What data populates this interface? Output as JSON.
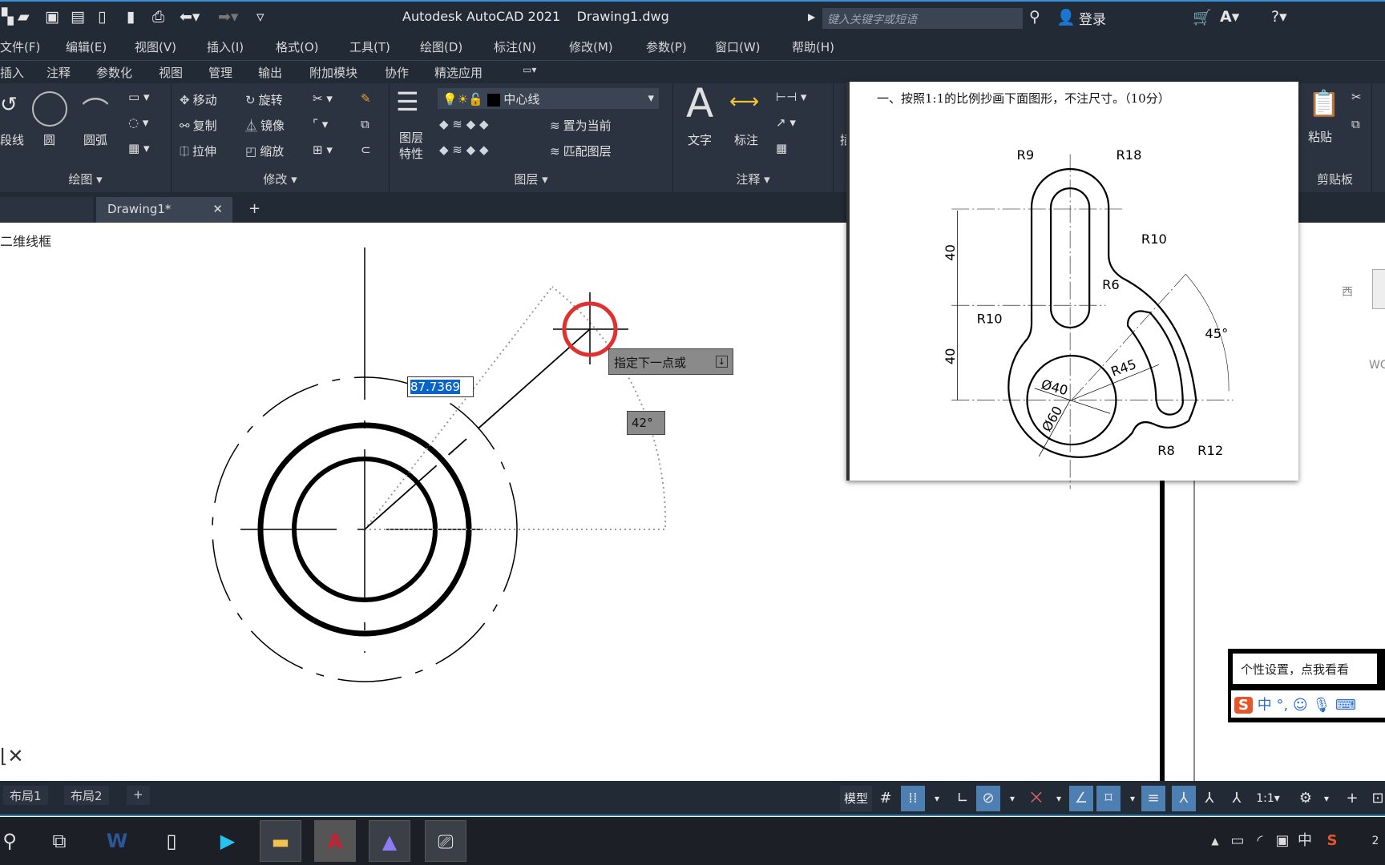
{
  "titlebar": {
    "app_title": "Autodesk AutoCAD 2021    Drawing1.dwg",
    "search_placeholder": "键入关键字或短语",
    "login": "登录",
    "icons": [
      "new-icon",
      "open-icon",
      "save-icon",
      "saveas-icon",
      "import-icon",
      "export-icon",
      "print-icon",
      "undo-icon",
      "redo-icon",
      "customize-icon",
      "search-icon",
      "user-icon",
      "cart-icon",
      "autodesk-icon",
      "help-icon"
    ]
  },
  "menu": [
    "文件(F)",
    "编辑(E)",
    "视图(V)",
    "插入(I)",
    "格式(O)",
    "工具(T)",
    "绘图(D)",
    "标注(N)",
    "修改(M)",
    "参数(P)",
    "窗口(W)",
    "帮助(H)"
  ],
  "ribbon_tabs": [
    "插入",
    "注释",
    "参数化",
    "视图",
    "管理",
    "输出",
    "附加模块",
    "协作",
    "精选应用"
  ],
  "ribbon": {
    "draw": {
      "title": "绘图",
      "tools": [
        "段线",
        "圆",
        "圆弧"
      ]
    },
    "modify": {
      "title": "修改",
      "tools": [
        "移动",
        "旋转",
        "复制",
        "镜像",
        "拉伸",
        "缩放"
      ]
    },
    "layer": {
      "title": "图层",
      "properties": "图层特性",
      "current_layer": "中心线",
      "set_current": "置为当前",
      "match": "匹配图层"
    },
    "annotate": {
      "title": "注释",
      "text": "文字",
      "dim": "标注"
    },
    "insert": {
      "label": "插入"
    },
    "clipboard": {
      "title": "剪贴板",
      "paste": "粘贴"
    }
  },
  "doc_tab": {
    "name": "Drawing1*"
  },
  "canvas": {
    "view_label": "二维线框",
    "dyn_input_value": "87.7369",
    "prompt": "指定下一点或",
    "angle": "42°",
    "viewcube_label": "西",
    "wcs": "WC"
  },
  "reference": {
    "instruction": "一、按照1:1的比例抄画下面图形，不注尺寸。（10分）",
    "labels": [
      "R9",
      "R18",
      "R10",
      "R6",
      "45°",
      "R10",
      "R45",
      "Ø40",
      "Ø60",
      "R8",
      "R12",
      "40",
      "40"
    ]
  },
  "layout_tabs": [
    "布局1",
    "布局2",
    "+"
  ],
  "status": {
    "model": "模型",
    "scale": "1:1"
  },
  "ime": {
    "tip": "个性设置，点我看看",
    "mode": "中"
  },
  "tray": {
    "ime": "中",
    "clock": "2"
  },
  "colors": {
    "accent": "#4d7fb3",
    "cursor_ring": "#e03030",
    "ui_dark": "#222a35"
  }
}
